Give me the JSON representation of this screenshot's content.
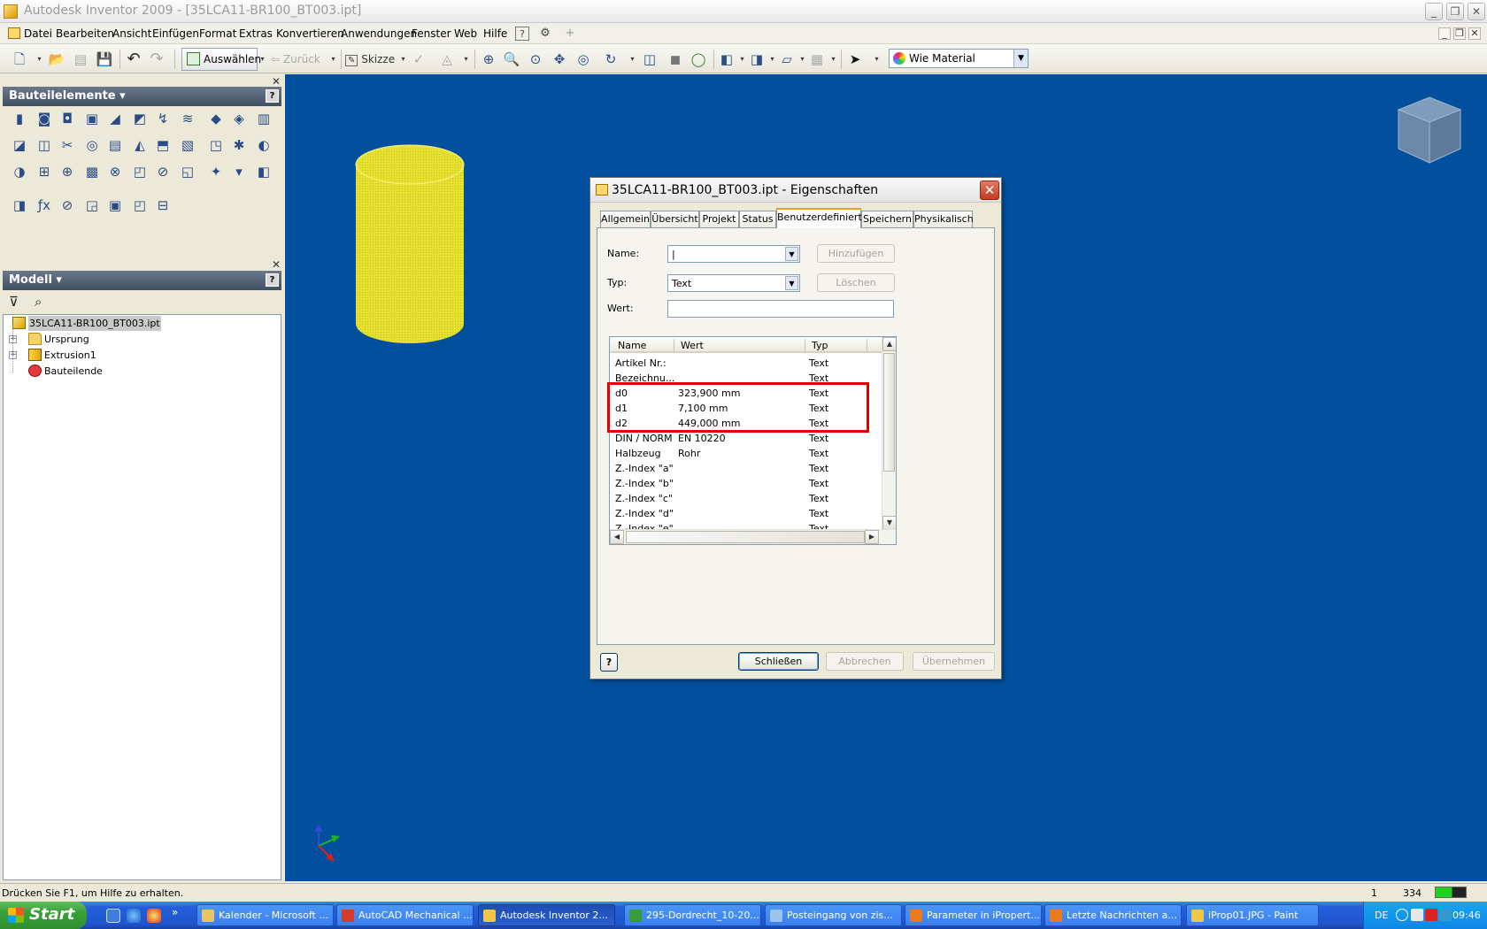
{
  "window": {
    "title": "Autodesk Inventor 2009 - [35LCA11-BR100_BT003.ipt]",
    "minimize_glyph": "_",
    "restore_glyph": "❐",
    "close_glyph": "✕"
  },
  "menubar": {
    "items": [
      "Datei",
      "Bearbeiten",
      "Ansicht",
      "Einfügen",
      "Format",
      "Extras",
      "Konvertieren",
      "Anwendungen",
      "Fenster",
      "Web",
      "Hilfe"
    ],
    "help_glyph": "?",
    "plus_glyph": "+",
    "mdi_glyphs": [
      "_",
      "❐",
      "✕"
    ]
  },
  "toolbar": {
    "select_label": "Auswählen",
    "back_label": "Zurück",
    "sketch_label": "Skizze",
    "material_value": "Wie Material",
    "glyphs": {
      "new": "🗋",
      "open": "📂",
      "save_dis": "▤",
      "save": "💾",
      "undo": "↶",
      "redo": "↷",
      "caret": "▾",
      "zoom_all": "⊕",
      "zoom": "🔍",
      "zoom_win": "⊙",
      "pan": "✥",
      "zoom_sel": "◎",
      "orbit": "↻",
      "look": "◫",
      "shade": "◼",
      "wire": "◯",
      "box": "◧",
      "box2": "◨",
      "slice": "▱",
      "grid": "▦",
      "arrow": "➤",
      "down": "▼"
    }
  },
  "panels": {
    "features_title": "Bauteilelemente",
    "model_title": "Modell",
    "help_glyph": "?",
    "close_glyph": "✕",
    "filter_glyph": "⊽",
    "find_glyph": "⌕",
    "feature_icons": [
      "▮",
      "◙",
      "◘",
      "▣",
      "◢",
      "◩",
      "↯",
      "≋",
      "◆",
      "◈",
      "▥",
      "◪",
      "◫",
      "✂",
      "◎",
      "▤",
      "◭",
      "⬒",
      "▧",
      "◳",
      "✱",
      "◐",
      "◑",
      "⊞",
      "⊕",
      "▩",
      "⊗",
      "◰",
      "⊘",
      "◱",
      "✦",
      "▾",
      "◧",
      "◨",
      "ƒx",
      "⊘",
      "◲",
      "▣",
      "◰",
      "⊟"
    ]
  },
  "tree": {
    "root": "35LCA11-BR100_BT003.ipt",
    "items": [
      {
        "label": "Ursprung",
        "expander": "+"
      },
      {
        "label": "Extrusion1",
        "expander": "+"
      },
      {
        "label": "Bauteilende",
        "expander": ""
      }
    ]
  },
  "dialog": {
    "title": "35LCA11-BR100_BT003.ipt - Eigenschaften",
    "close_glyph": "✕",
    "tabs": [
      "Allgemein",
      "Übersicht",
      "Projekt",
      "Status",
      "Benutzerdefiniert",
      "Speichern",
      "Physikalisch"
    ],
    "active_tab": "Benutzerdefiniert",
    "name_label": "Name:",
    "name_value": "|",
    "type_label": "Typ:",
    "type_value": "Text",
    "value_label": "Wert:",
    "add_button": "Hinzufügen",
    "delete_button": "Löschen",
    "combo_arrow": "▼",
    "columns": [
      "Name",
      "Wert",
      "Typ"
    ],
    "rows": [
      {
        "name": "Artikel Nr.:",
        "value": "",
        "type": "Text"
      },
      {
        "name": "Bezeichnu...",
        "value": "",
        "type": "Text"
      },
      {
        "name": "d0",
        "value": "323,900 mm",
        "type": "Text"
      },
      {
        "name": "d1",
        "value": "7,100 mm",
        "type": "Text"
      },
      {
        "name": "d2",
        "value": "449,000 mm",
        "type": "Text"
      },
      {
        "name": "DIN / NORM",
        "value": "EN 10220",
        "type": "Text"
      },
      {
        "name": "Halbzeug",
        "value": "Rohr",
        "type": "Text"
      },
      {
        "name": "Z.-Index \"a\"",
        "value": "",
        "type": "Text"
      },
      {
        "name": "Z.-Index \"b\"",
        "value": "",
        "type": "Text"
      },
      {
        "name": "Z.-Index \"c\"",
        "value": "",
        "type": "Text"
      },
      {
        "name": "Z.-Index \"d\"",
        "value": "",
        "type": "Text"
      },
      {
        "name": "Z.-Index \"e\"",
        "value": "",
        "type": "Text"
      }
    ],
    "scroll_glyphs": {
      "up": "▲",
      "down": "▼",
      "left": "◀",
      "right": "▶"
    },
    "help_glyph": "?",
    "close_button": "Schließen",
    "cancel_button": "Abbrechen",
    "apply_button": "Übernehmen"
  },
  "statusbar": {
    "message": "Drücken Sie F1, um Hilfe zu erhalten.",
    "value1": "1",
    "value2": "334"
  },
  "taskbar": {
    "start_label": "Start",
    "tasks": [
      {
        "label": "Kalender - Microsoft ...",
        "color": "#e8c56a",
        "active": false
      },
      {
        "label": "AutoCAD Mechanical ...",
        "color": "#d33b2c",
        "active": false
      },
      {
        "label": "Autodesk Inventor 2...",
        "color": "#f2c64a",
        "active": true
      },
      {
        "label": "295-Dordrecht_10-20...",
        "color": "#3a9b3a",
        "active": false
      },
      {
        "label": "Posteingang von zis...",
        "color": "#9cc3ef",
        "active": false
      },
      {
        "label": "Parameter in iPropert...",
        "color": "#e87a1f",
        "active": false
      },
      {
        "label": "Letzte Nachrichten a...",
        "color": "#e87a1f",
        "active": false
      },
      {
        "label": "iProp01.JPG - Paint",
        "color": "#f2c64a",
        "active": false
      }
    ],
    "language": "DE",
    "clock": "09:46"
  },
  "colors": {
    "viewport": "#02509d",
    "cylinder": "#e5df2f",
    "highlight": "#e00000"
  }
}
